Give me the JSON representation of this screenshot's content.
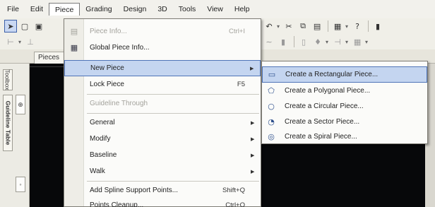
{
  "menubar": {
    "items": [
      {
        "label": "File"
      },
      {
        "label": "Edit"
      },
      {
        "label": "Piece"
      },
      {
        "label": "Grading"
      },
      {
        "label": "Design"
      },
      {
        "label": "3D"
      },
      {
        "label": "Tools"
      },
      {
        "label": "View"
      },
      {
        "label": "Help"
      }
    ],
    "active": "Piece"
  },
  "tabs": {
    "pieces": "Pieces"
  },
  "left_panel": {
    "toolbox": "Toolbox",
    "guideline_table": "Guideline Table"
  },
  "piece_menu": {
    "items": [
      {
        "icon": "piece-info-icon",
        "glyph": "▤",
        "label": "Piece Info...",
        "shortcut": "Ctrl+I",
        "disabled": true
      },
      {
        "icon": "global-piece-info-icon",
        "glyph": "▦",
        "label": "Global Piece Info...",
        "shortcut": "",
        "disabled": false
      },
      {
        "icon": "",
        "glyph": "",
        "label": "New Piece",
        "shortcut": "",
        "submenu": true,
        "highlight": true
      },
      {
        "icon": "",
        "glyph": "",
        "label": "Lock Piece",
        "shortcut": "F5"
      },
      {
        "icon": "",
        "glyph": "",
        "label": "Guideline Through",
        "shortcut": "",
        "disabled": true
      },
      {
        "icon": "",
        "glyph": "",
        "label": "General",
        "shortcut": "",
        "submenu": true
      },
      {
        "icon": "",
        "glyph": "",
        "label": "Modify",
        "shortcut": "",
        "submenu": true
      },
      {
        "icon": "",
        "glyph": "",
        "label": "Baseline",
        "shortcut": "",
        "submenu": true
      },
      {
        "icon": "",
        "glyph": "",
        "label": "Walk",
        "shortcut": "",
        "submenu": true
      },
      {
        "icon": "",
        "glyph": "",
        "label": "Add Spline Support Points...",
        "shortcut": "Shift+Q"
      },
      {
        "icon": "",
        "glyph": "",
        "label": "Points Cleanup...",
        "shortcut": "Ctrl+Q"
      }
    ]
  },
  "new_piece_submenu": {
    "items": [
      {
        "icon": "rectangle-icon",
        "glyph": "▭",
        "label": "Create a Rectangular Piece...",
        "highlight": true
      },
      {
        "icon": "polygon-icon",
        "glyph": "⬠",
        "label": "Create a Polygonal Piece..."
      },
      {
        "icon": "circle-icon",
        "glyph": "○",
        "label": "Create a Circular Piece..."
      },
      {
        "icon": "sector-icon",
        "glyph": "◔",
        "label": "Create a Sector Piece..."
      },
      {
        "icon": "spiral-icon",
        "glyph": "◎",
        "label": "Create a Spiral Piece..."
      }
    ]
  },
  "colors": {
    "highlight": "#c4d5f0",
    "highlight_border": "#4f74b8",
    "workspace": "#07080a"
  }
}
